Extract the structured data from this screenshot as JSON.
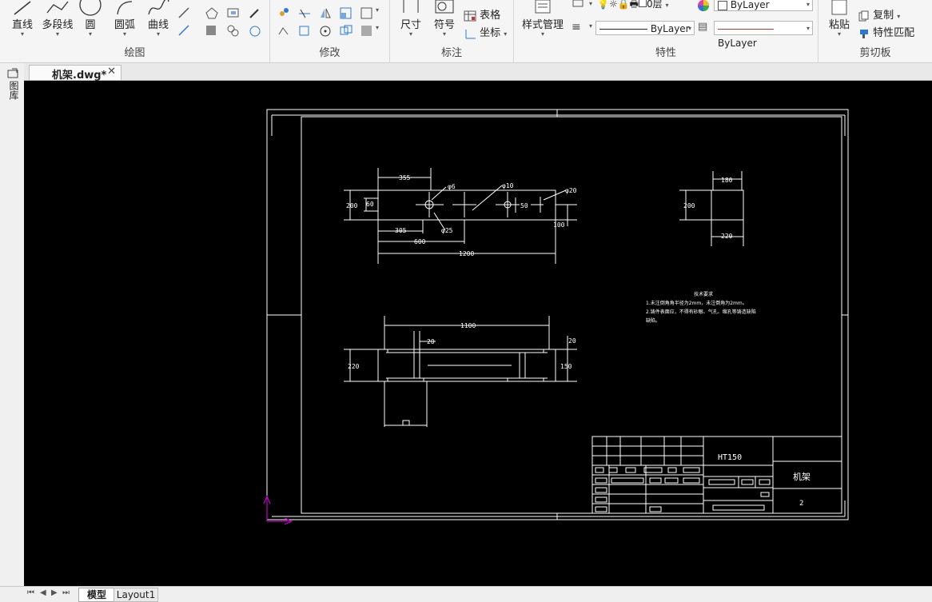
{
  "ribbon": {
    "draw": {
      "group_label": "绘图",
      "line": "直线",
      "polyline": "多段线",
      "circle": "圆",
      "arc": "圆弧",
      "curve": "曲线"
    },
    "modify": {
      "group_label": "修改"
    },
    "annotation": {
      "group_label": "标注",
      "dimension": "尺寸",
      "symbol": "符号",
      "table": "表格",
      "coordinate": "坐标"
    },
    "properties": {
      "group_label": "特性",
      "style_manager": "样式管理",
      "layer_value": "0层",
      "color_value": "ByLayer",
      "linetype_value": "ByLayer",
      "lineweight_value": "ByLayer"
    },
    "clipboard": {
      "group_label": "剪切板",
      "paste": "粘贴",
      "copy": "复制",
      "match_properties": "特性匹配"
    }
  },
  "document_tab": {
    "title": "机架.dwg*",
    "close_icon": "close-icon"
  },
  "palette": {
    "label": "图库"
  },
  "drawing": {
    "dims": {
      "d355": "355",
      "phi6": "φ6",
      "phi10": "φ10",
      "phi20": "φ20",
      "d200": "200",
      "d60": "60",
      "d50": "50",
      "d100": "100",
      "d305": "305",
      "phi25": "φ25",
      "d600": "600",
      "d1200": "1200",
      "d180": "180",
      "d200b": "200",
      "d220": "220",
      "d1100": "1100",
      "d20": "20",
      "d20b": "20",
      "d220b": "220",
      "d150": "150"
    },
    "notes": {
      "title": "技术要求",
      "line1": "1.未注倒角角半径为2mm，未注倒角为2mm。",
      "line2": "2.铸件表面应，不得有砂眼、气孔、缩孔等铸造缺陷",
      "line3": "缺陷。"
    },
    "title_block": {
      "material": "HT150",
      "part_name": "机架",
      "sheet": "2"
    }
  },
  "bottom_tabs": {
    "model": "模型",
    "layout1": "Layout1"
  },
  "colors": {
    "canvas": "#000000",
    "drawing_lines": "#ffffff",
    "ucs": "#c000c0",
    "accent_red": "#c0392b"
  }
}
